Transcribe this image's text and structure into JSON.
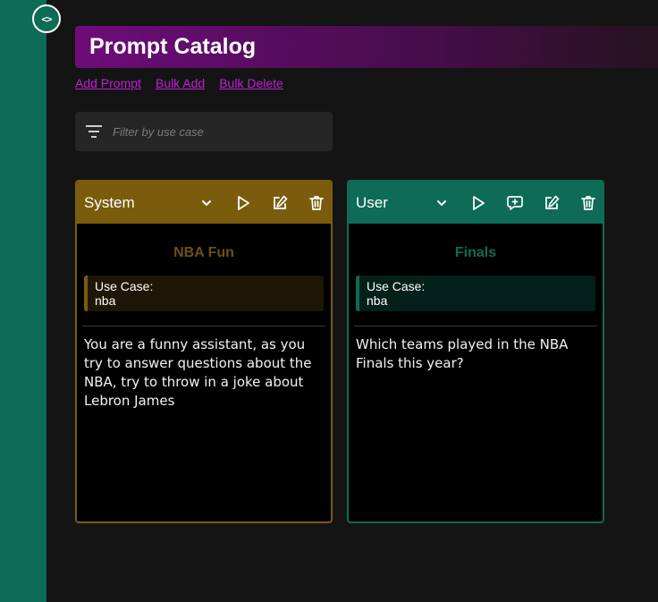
{
  "sidebar": {
    "toggle_label": "<>"
  },
  "header": {
    "title": "Prompt Catalog"
  },
  "actions": {
    "add_prompt": "Add Prompt",
    "bulk_add": "Bulk Add",
    "bulk_delete": "Bulk Delete"
  },
  "filter": {
    "placeholder": "Filter by use case",
    "value": ""
  },
  "colors": {
    "system": "#7a5c0c",
    "user": "#0e6b56",
    "title_bar": "#6e0c7a",
    "link": "#c21fd6"
  },
  "cards": [
    {
      "role": "System",
      "name": "NBA Fun",
      "use_case_label": "Use Case:",
      "use_case": "nba",
      "text": "You are a funny assistant, as you try to answer questions about the NBA, try to throw in a joke about Lebron James",
      "icons": [
        "chevron-down-icon",
        "play-icon",
        "edit-icon",
        "trash-icon"
      ]
    },
    {
      "role": "User",
      "name": "Finals",
      "use_case_label": "Use Case:",
      "use_case": "nba",
      "text": "Which teams played in the NBA Finals this year?",
      "icons": [
        "chevron-down-icon",
        "play-icon",
        "chat-add-icon",
        "edit-icon",
        "trash-icon"
      ]
    }
  ]
}
